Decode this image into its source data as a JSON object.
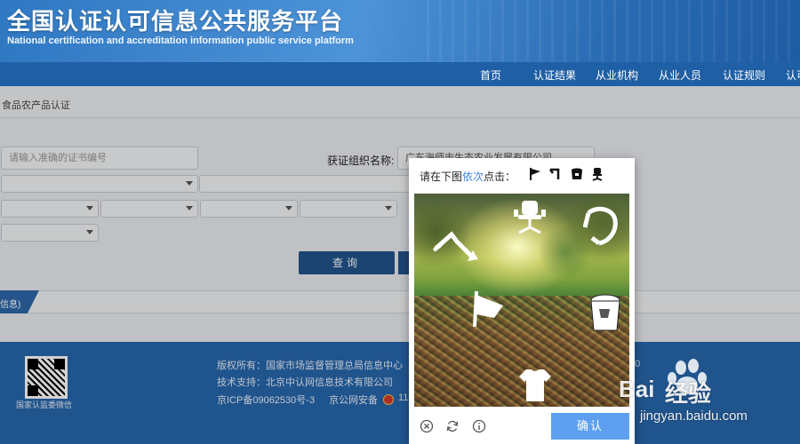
{
  "header": {
    "title_cn": "全国认证认可信息公共服务平台",
    "title_en": "National certification and accreditation information public service platform"
  },
  "nav": {
    "items": [
      {
        "label": "首页"
      },
      {
        "label": "认证结果"
      },
      {
        "label": "从业机构"
      },
      {
        "label": "从业人员"
      },
      {
        "label": "认证规则"
      },
      {
        "label": "认可"
      }
    ]
  },
  "breadcrumb": "食品农产品认证",
  "search": {
    "cert_placeholder": "请输入准确的证书编号",
    "org_label": "获证组织名称:",
    "org_value": "广东海师市生态农业发展有限公司",
    "query_label": "查询"
  },
  "result_tab": {
    "label": "信息)"
  },
  "footer": {
    "qr_label": "国家认监委微信",
    "copyright": "版权所有：国家市场监督管理总局信息中心",
    "tech_support": "技术支持：北京中认网信息技术有限公司",
    "icp": "京ICP备09062530号-3",
    "police": "京公网安备",
    "police_num": "11",
    "right_fragment": "20"
  },
  "captcha": {
    "prompt_before": "请在下图",
    "prompt_highlight": "依次",
    "prompt_after": "点击：",
    "targets": [
      "flag-icon",
      "hook-icon",
      "bucket-icon",
      "chair-icon"
    ],
    "confirm_label": "确认",
    "tools": [
      "close-icon",
      "refresh-icon",
      "info-icon"
    ],
    "highlight_color": "#3f86e0",
    "confirm_color": "#5ea0ef"
  },
  "watermark": {
    "brand_bai": "Bai",
    "brand_text": "经验",
    "url": "jingyan.baidu.com"
  }
}
